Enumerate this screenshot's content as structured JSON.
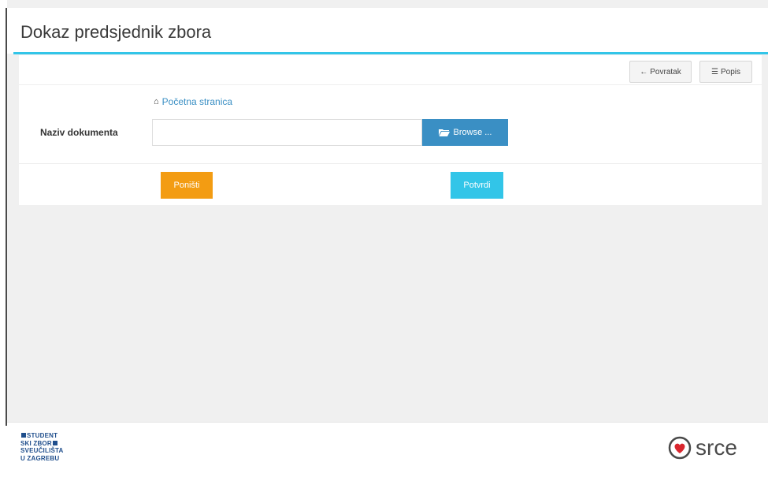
{
  "header": {
    "title": "Dokaz predsjednik zbora"
  },
  "toolbar": {
    "back_label": "Povratak",
    "list_label": "Popis"
  },
  "breadcrumb": {
    "home_label": "Početna stranica"
  },
  "form": {
    "document_label": "Naziv dokumenta",
    "document_value": "",
    "browse_label": "Browse ...",
    "cancel_label": "Poništi",
    "confirm_label": "Potvrdi"
  },
  "footer": {
    "left_logo_lines": [
      "STUDENT",
      "SKI ZBOR",
      "SVEUČILIŠTA",
      "U ZAGREBU"
    ],
    "right_logo_text": "srce"
  },
  "colors": {
    "accent": "#32c5e8",
    "primary": "#3a8fc4",
    "warning": "#f39c12"
  },
  "icons": {
    "back": "arrow-left-icon",
    "list": "list-icon",
    "home": "home-icon",
    "browse": "folder-open-icon"
  }
}
